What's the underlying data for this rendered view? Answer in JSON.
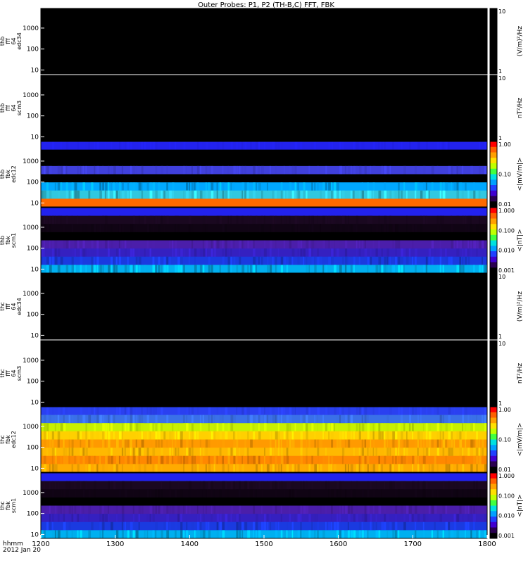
{
  "title": "Outer Probes: P1, P2 (TH-B,C) FFT, FBK",
  "time_axis": {
    "label_line1": "hhmm",
    "label_line2": "2012 Jan 20",
    "range": [
      1200,
      1800
    ],
    "ticks": [
      "1200",
      "1300",
      "1400",
      "1500",
      "1600",
      "1700",
      "1800"
    ]
  },
  "panels": [
    {
      "ylabel": [
        "thb",
        "fff",
        "64",
        "edc34"
      ],
      "yticks": [
        "1000",
        "100",
        "10"
      ],
      "units": "(V/m)²/Hz",
      "cbar_ticks": [
        "10",
        "1"
      ],
      "kind": "empty"
    },
    {
      "ylabel": [
        "thb",
        "fff",
        "64",
        "scm3"
      ],
      "yticks": [
        "1000",
        "100",
        "10"
      ],
      "units": "nT²/Hz",
      "cbar_ticks": [
        "10",
        "1"
      ],
      "kind": "empty"
    },
    {
      "ylabel": [
        "thb",
        "fbk",
        "edc12"
      ],
      "yticks": [
        "1000",
        "100",
        "10"
      ],
      "units": "<|mV/m|>",
      "cbar_ticks": [
        "1.00",
        "0.10",
        "0.01"
      ],
      "kind": "spectro",
      "bands": [
        {
          "c": "#2222ee",
          "v": 0.1
        },
        {
          "c": "#000000",
          "v": 0.0
        },
        {
          "c": "#000000",
          "v": 0.0
        },
        {
          "c": "#4040dd",
          "v": 0.25
        },
        {
          "c": "#000000",
          "v": 0.0
        },
        {
          "c": "#00a8ff",
          "v": 0.55
        },
        {
          "c": "#30c8e0",
          "v": 0.55
        },
        {
          "c": "#ff6a00",
          "v": 0.0
        }
      ]
    },
    {
      "ylabel": [
        "thb",
        "fbk",
        "scm1"
      ],
      "yticks": [
        "1000",
        "100",
        "10"
      ],
      "units": "<|nT|>",
      "cbar_ticks": [
        "1.000",
        "0.100",
        "0.010",
        "0.001"
      ],
      "kind": "spectro",
      "bands": [
        {
          "c": "#2222ee",
          "v": 0.0
        },
        {
          "c": "#1a0820",
          "v": 0.3
        },
        {
          "c": "#100414",
          "v": 0.3
        },
        {
          "c": "#000000",
          "v": 0.0
        },
        {
          "c": "#4b1eaa",
          "v": 0.25
        },
        {
          "c": "#3520c0",
          "v": 0.3
        },
        {
          "c": "#1a3ae0",
          "v": 0.45
        },
        {
          "c": "#00b0f0",
          "v": 0.6
        }
      ]
    },
    {
      "ylabel": [
        "thc",
        "fff",
        "64",
        "edc34"
      ],
      "yticks": [
        "1000",
        "100",
        "10"
      ],
      "units": "(V/m)²/Hz",
      "cbar_ticks": [
        "10",
        "1"
      ],
      "kind": "empty"
    },
    {
      "ylabel": [
        "thc",
        "fff",
        "64",
        "scm3"
      ],
      "yticks": [
        "1000",
        "100",
        "10"
      ],
      "units": "nT²/Hz",
      "cbar_ticks": [
        "10",
        "1"
      ],
      "kind": "empty"
    },
    {
      "ylabel": [
        "thc",
        "fbk",
        "edc12"
      ],
      "yticks": [
        "1000",
        "100",
        "10"
      ],
      "units": "<|mV/m|>",
      "cbar_ticks": [
        "1.00",
        "0.10",
        "0.01"
      ],
      "kind": "spectro",
      "bands": [
        {
          "c": "#2a40f0",
          "v": 0.2
        },
        {
          "c": "#3a70e8",
          "v": 0.35
        },
        {
          "c": "#c8f000",
          "v": 0.3
        },
        {
          "c": "#ffd000",
          "v": 0.35
        },
        {
          "c": "#ff9a00",
          "v": 0.4
        },
        {
          "c": "#ffb800",
          "v": 0.4
        },
        {
          "c": "#ff8800",
          "v": 0.4
        },
        {
          "c": "#ffaa00",
          "v": 0.4
        }
      ]
    },
    {
      "ylabel": [
        "thc",
        "fbk",
        "scm1"
      ],
      "yticks": [
        "1000",
        "100",
        "10"
      ],
      "units": "<|nT|>",
      "cbar_ticks": [
        "1.000",
        "0.100",
        "0.010",
        "0.001"
      ],
      "kind": "spectro",
      "bands": [
        {
          "c": "#2222ee",
          "v": 0.0
        },
        {
          "c": "#1a0820",
          "v": 0.3
        },
        {
          "c": "#100414",
          "v": 0.3
        },
        {
          "c": "#000000",
          "v": 0.0
        },
        {
          "c": "#4b1eaa",
          "v": 0.25
        },
        {
          "c": "#3520c0",
          "v": 0.3
        },
        {
          "c": "#1a3ae0",
          "v": 0.45
        },
        {
          "c": "#00b0f0",
          "v": 0.6
        }
      ]
    }
  ],
  "chart_data": {
    "type": "heatmap",
    "title": "Outer Probes: P1, P2 (TH-B,C) FFT, FBK",
    "xlabel": "hhmm",
    "x_range": [
      1200,
      1800
    ],
    "x_ticks": [
      1200,
      1300,
      1400,
      1500,
      1600,
      1700,
      1800
    ],
    "y_scale": "log",
    "y_ticks": [
      10,
      100,
      1000
    ],
    "panels": [
      "thb fff 64 edc34",
      "thb fff 64 scm3",
      "thb fbk edc12",
      "thb fbk scm1",
      "thc fff 64 edc34",
      "thc fff 64 scm3",
      "thc fbk edc12",
      "thc fbk scm1"
    ],
    "colorbar_scales": [
      "(V/m)²/Hz",
      "nT²/Hz",
      "<|mV/m|>",
      "<|nT|>",
      "(V/m)²/Hz",
      "nT²/Hz",
      "<|mV/m|>",
      "<|nT|>"
    ]
  }
}
